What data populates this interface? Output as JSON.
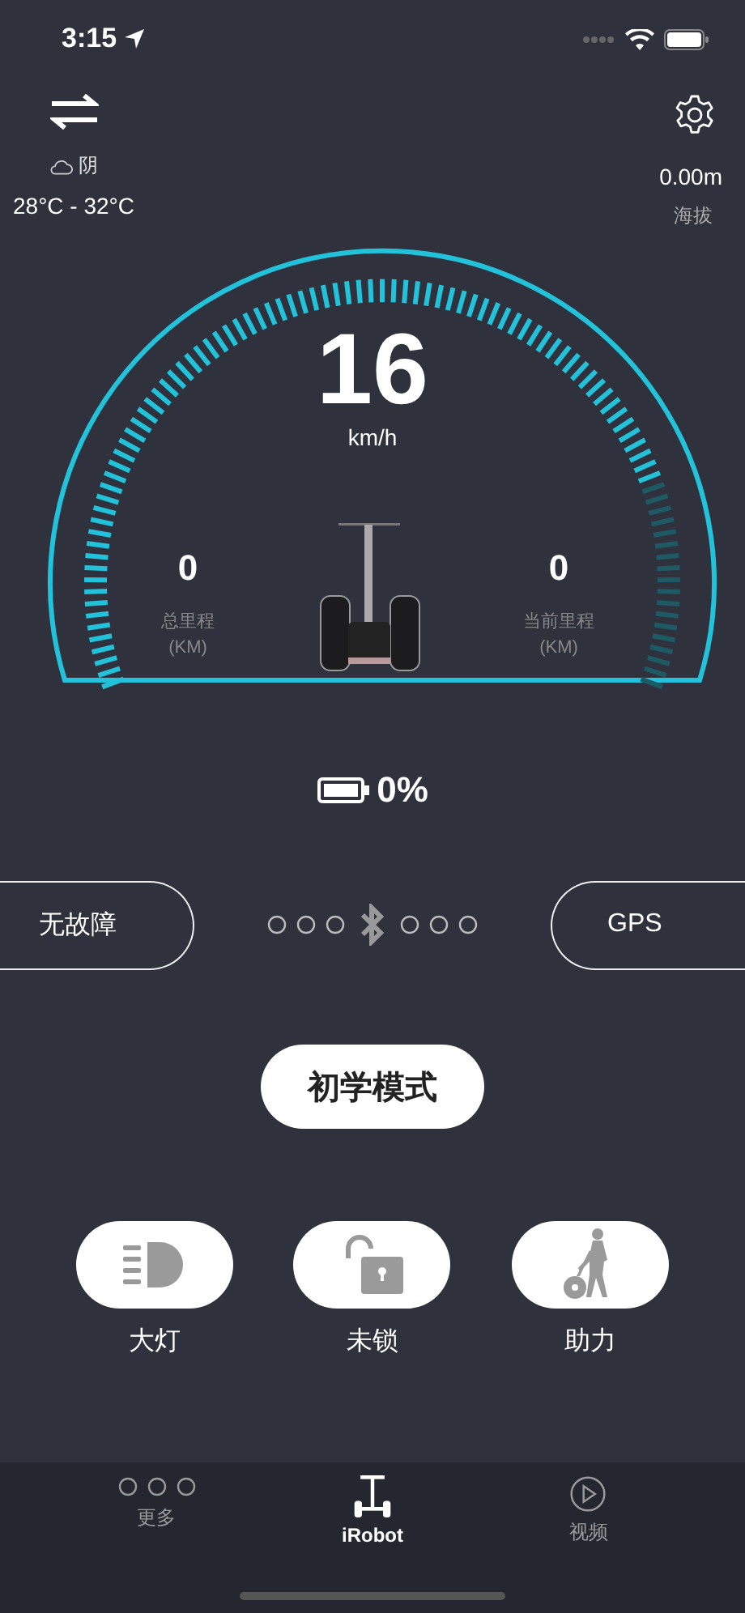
{
  "status_bar": {
    "time": "3:15"
  },
  "header": {
    "weather": {
      "condition": "阴",
      "temperature": "28°C - 32°C"
    },
    "altitude": {
      "value": "0.00m",
      "label": "海拔"
    }
  },
  "gauge": {
    "speed": "16",
    "unit": "km/h",
    "odometers": [
      {
        "value": "0",
        "label": "总里程",
        "unit": "(KM)"
      },
      {
        "value": "0",
        "label": "当前里程",
        "unit": "(KM)"
      }
    ]
  },
  "battery": {
    "reading": "0%"
  },
  "status_pills": [
    {
      "label": "无故障"
    },
    {
      "label": "GPS"
    }
  ],
  "mode_button": {
    "label": "初学模式"
  },
  "controls": [
    {
      "kind": "headlight",
      "label": "大灯"
    },
    {
      "kind": "lock",
      "label": "未锁"
    },
    {
      "kind": "assist",
      "label": "助力"
    }
  ],
  "tabs": [
    {
      "kind": "more",
      "label": "更多",
      "selected": false
    },
    {
      "kind": "robot",
      "label": "iRobot",
      "selected": true
    },
    {
      "kind": "video",
      "label": "视频",
      "selected": false
    }
  ]
}
